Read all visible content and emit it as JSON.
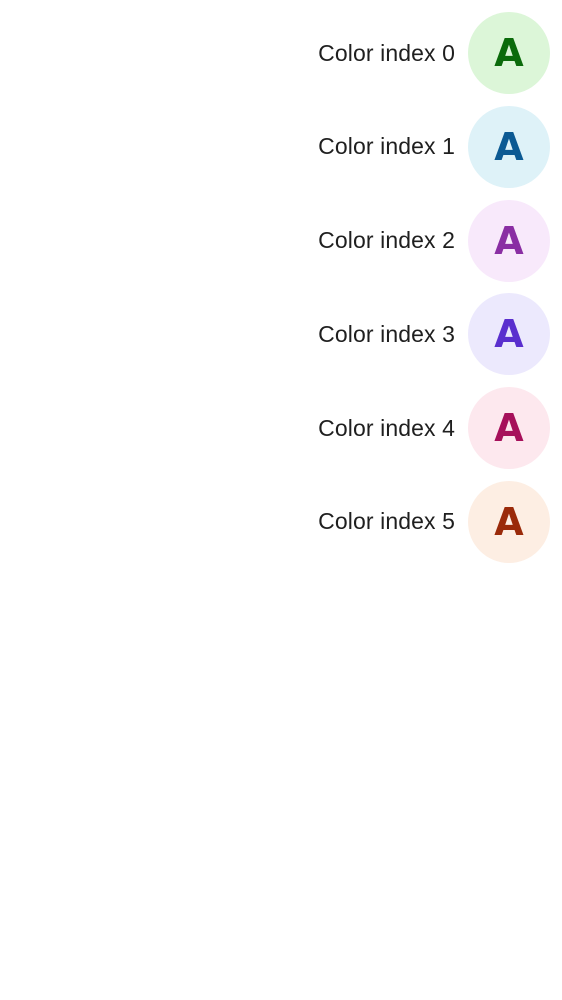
{
  "rows": [
    {
      "label": "Color index 0",
      "letter": "A",
      "bg": "#dcf6d8",
      "fg": "#0b6b0b"
    },
    {
      "label": "Color index 1",
      "letter": "A",
      "bg": "#def2f8",
      "fg": "#0c5a93"
    },
    {
      "label": "Color index 2",
      "letter": "A",
      "bg": "#f8e9fb",
      "fg": "#8a2ea3"
    },
    {
      "label": "Color index 3",
      "letter": "A",
      "bg": "#ece9fd",
      "fg": "#5a2fce"
    },
    {
      "label": "Color index 4",
      "letter": "A",
      "bg": "#fde8ee",
      "fg": "#a6105a"
    },
    {
      "label": "Color index 5",
      "letter": "A",
      "bg": "#fdeee3",
      "fg": "#9a2a0a"
    }
  ]
}
